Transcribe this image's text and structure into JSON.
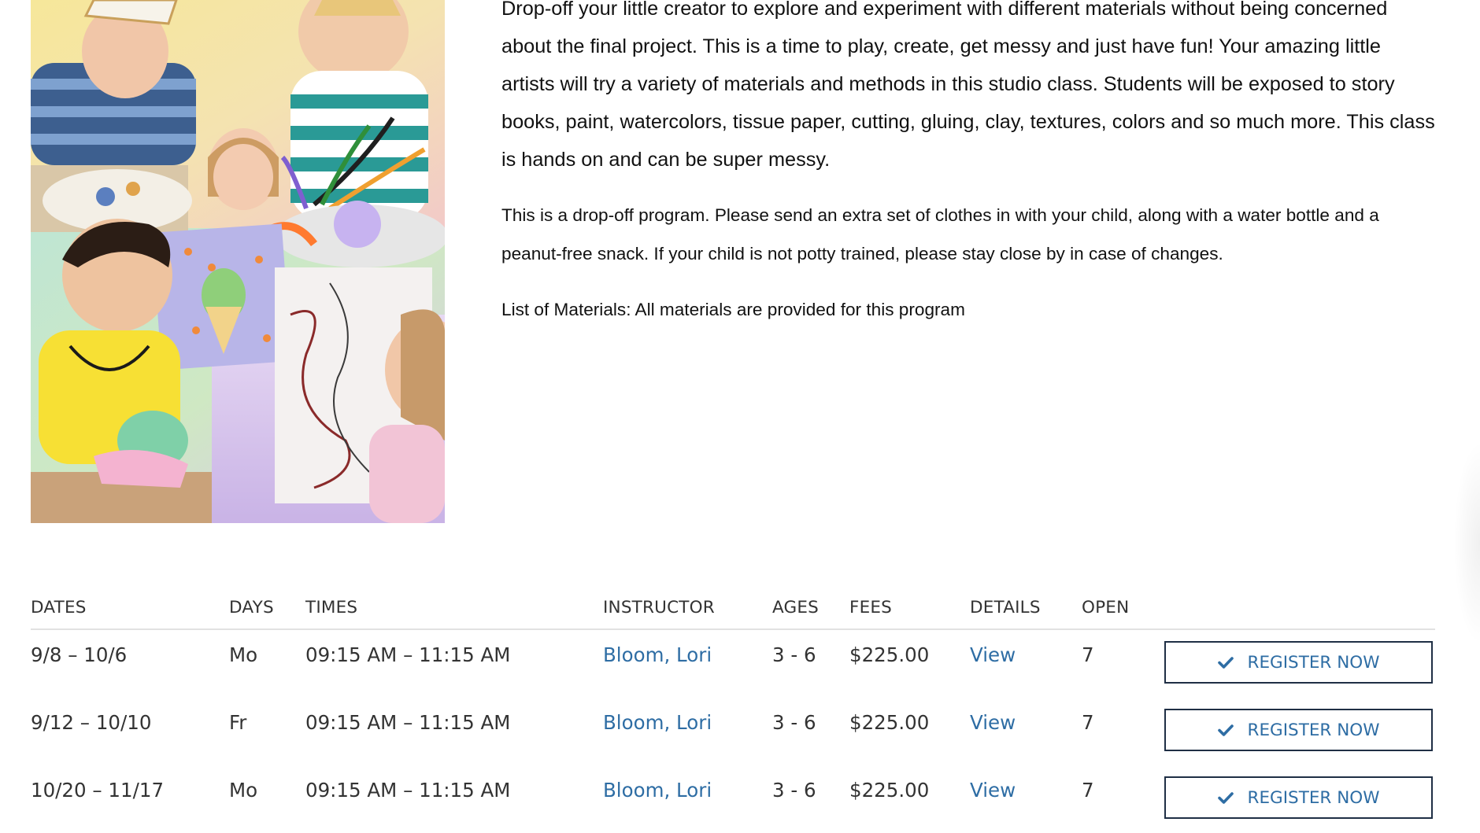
{
  "description": {
    "paragraph_1": "Drop-off your little creator to explore and experiment with different materials without being concerned about the final project. This is a time to play, create, get messy and just have fun! Your amazing little artists will try a variety of materials and methods in this studio class. Students will be exposed to story books, paint, watercolors, tissue paper, cutting, gluing, clay, textures, colors and so much more. This class is hands on and can be super messy.",
    "paragraph_2": "This is a drop-off program. Please send an extra set of clothes in with your child, along with a water bottle and a peanut-free snack. If your child is not potty trained, please stay close by in case of changes.",
    "paragraph_3": "List of Materials: All materials are provided for this program"
  },
  "table": {
    "headers": {
      "dates": "DATES",
      "days": "DAYS",
      "times": "TIMES",
      "instructor": "INSTRUCTOR",
      "ages": "AGES",
      "fees": "FEES",
      "details": "DETAILS",
      "open": "OPEN"
    },
    "rows": [
      {
        "dates": "9/8 – 10/6",
        "days": "Mo",
        "times": "09:15 AM – 11:15 AM",
        "instructor": "Bloom, Lori",
        "ages": "3 - 6",
        "fees": "$225.00",
        "details": "View",
        "open": "7",
        "button": "REGISTER NOW"
      },
      {
        "dates": "9/12 – 10/10",
        "days": "Fr",
        "times": "09:15 AM – 11:15 AM",
        "instructor": "Bloom, Lori",
        "ages": "3 - 6",
        "fees": "$225.00",
        "details": "View",
        "open": "7",
        "button": "REGISTER NOW"
      },
      {
        "dates": "10/20 – 11/17",
        "days": "Mo",
        "times": "09:15 AM – 11:15 AM",
        "instructor": "Bloom, Lori",
        "ages": "3 - 6",
        "fees": "$225.00",
        "details": "View",
        "open": "7",
        "button": "REGISTER NOW"
      }
    ]
  },
  "icons": {
    "register_button_icon": "check-icon"
  },
  "colors": {
    "link": "#2e6da4",
    "button_border": "#1f2f45",
    "text": "#111111"
  }
}
